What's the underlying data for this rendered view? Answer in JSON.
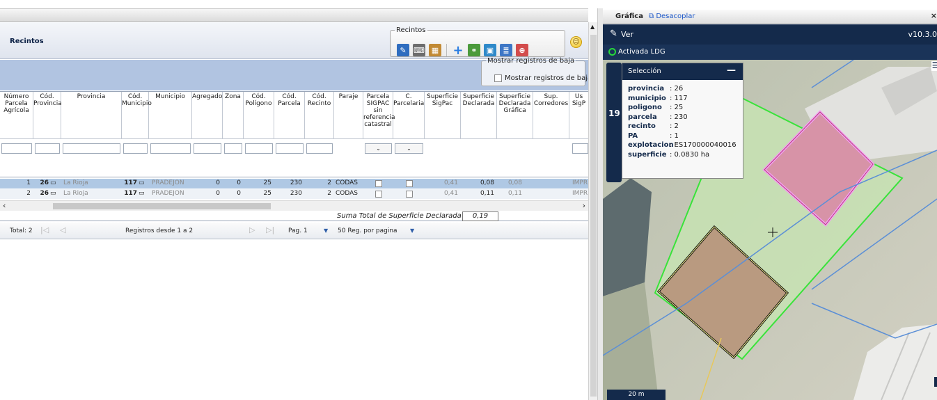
{
  "left": {
    "collapse_icon": "‹",
    "title": "Recintos",
    "toolbar": {
      "legend": "Recintos"
    },
    "baja": {
      "legend": "Mostrar registros de baja",
      "checkbox_label": "Mostrar registros de baja"
    },
    "columns": [
      [
        "Número",
        "Parcela",
        "Agrícola"
      ],
      [
        "Cód.",
        "Provincia"
      ],
      [
        "Provincia"
      ],
      [
        "Cód.",
        "Municipio"
      ],
      [
        "Municipio"
      ],
      [
        "Agregado"
      ],
      [
        "Zona"
      ],
      [
        "Cód.",
        "Polígono"
      ],
      [
        "Cód.",
        "Parcela"
      ],
      [
        "Cód.",
        "Recinto"
      ],
      [
        "Paraje"
      ],
      [
        "Parcela",
        "SIGPAC",
        "sin",
        "referencia",
        "catastral"
      ],
      [
        "C.",
        "Parcelaria"
      ],
      [
        "Superficie",
        "SigPac"
      ],
      [
        "Superficie",
        "Declarada"
      ],
      [
        "Superficie",
        "Declarada",
        "Gráfica"
      ],
      [
        "Sup.",
        "Corredores"
      ],
      [
        "Us",
        "SigP"
      ]
    ],
    "rows": [
      {
        "num": "1",
        "cod_prov": "26",
        "provincia": "La Rioja",
        "cod_mun": "117",
        "municipio": "PRADEJON",
        "agregado": "0",
        "zona": "0",
        "poligono": "25",
        "parcela": "230",
        "recinto": "2",
        "paraje": "CODAS",
        "sup_sigpac": "0,41",
        "sup_declarada": "0,08",
        "sup_grafica": "0,08",
        "uso": "IMPR"
      },
      {
        "num": "2",
        "cod_prov": "26",
        "provincia": "La Rioja",
        "cod_mun": "117",
        "municipio": "PRADEJON",
        "agregado": "0",
        "zona": "0",
        "poligono": "25",
        "parcela": "230",
        "recinto": "2",
        "paraje": "CODAS",
        "sup_sigpac": "0,41",
        "sup_declarada": "0,11",
        "sup_grafica": "0,11",
        "uso": "IMPR"
      }
    ],
    "sum_label": "Suma Total de Superficie Declarada",
    "sum_value": "0,19",
    "pager": {
      "total": "Total: 2",
      "registros": "Registros desde 1 a 2",
      "page": "Pag. 1",
      "per_page": "50 Reg. por pagina"
    }
  },
  "right": {
    "title": "Gráfica",
    "detach": "Desacoplar",
    "close": "×",
    "ver_label": "Ver",
    "version": "v10.3.0",
    "ldg_label": "Activada LDG",
    "side_number": "19",
    "selection": {
      "title": "Selección",
      "minimize": "—",
      "items": [
        {
          "k": "provincia",
          "v": ": 26"
        },
        {
          "k": "municipio",
          "v": ": 117"
        },
        {
          "k": "poligono",
          "v": ": 25"
        },
        {
          "k": "parcela",
          "v": ": 230"
        },
        {
          "k": "recinto",
          "v": ": 2"
        },
        {
          "k": "PA",
          "v": ": 1"
        },
        {
          "k": "explotacion",
          "v": ": ES170000040016"
        },
        {
          "k": "superficie",
          "v": ": 0.0830 ha"
        }
      ]
    },
    "scale": "20 m",
    "info": "i",
    "menu": "☰"
  }
}
